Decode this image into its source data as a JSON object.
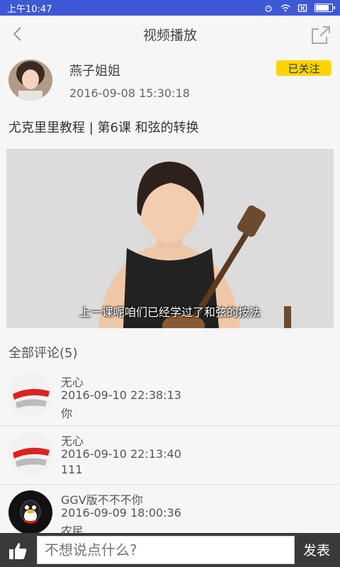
{
  "statusbar": {
    "time": "上午10:47"
  },
  "nav": {
    "title": "视频播放"
  },
  "author": {
    "name": "燕子姐姐",
    "time": "2016-09-08 15:30:18",
    "follow_label": "已关注"
  },
  "video": {
    "title": "尤克里里教程 | 第6课 和弦的转换",
    "subtitle": "上一课呢咱们已经学过了和弦的按法"
  },
  "comments_header": "全部评论(5)",
  "comments": [
    {
      "name": "无心",
      "time": "2016-09-10 22:38:13",
      "text": "你"
    },
    {
      "name": "无心",
      "time": "2016-09-10 22:13:40",
      "text": "111"
    },
    {
      "name": "GGV版不不不你",
      "time": "2016-09-09 18:00:36",
      "text": "农民"
    }
  ],
  "compose": {
    "placeholder": "不想说点什么?",
    "send_label": "发表"
  },
  "icons": {
    "back": "chevron-left-icon",
    "share": "share-icon",
    "like": "thumbs-up-icon",
    "alarm": "alarm-icon",
    "wifi": "wifi-icon",
    "sim": "sim-icon",
    "battery": "battery-icon"
  },
  "colors": {
    "statusbar": "#3f58d6",
    "follow": "#ffd400",
    "bottombar": "#3a3a3a"
  }
}
